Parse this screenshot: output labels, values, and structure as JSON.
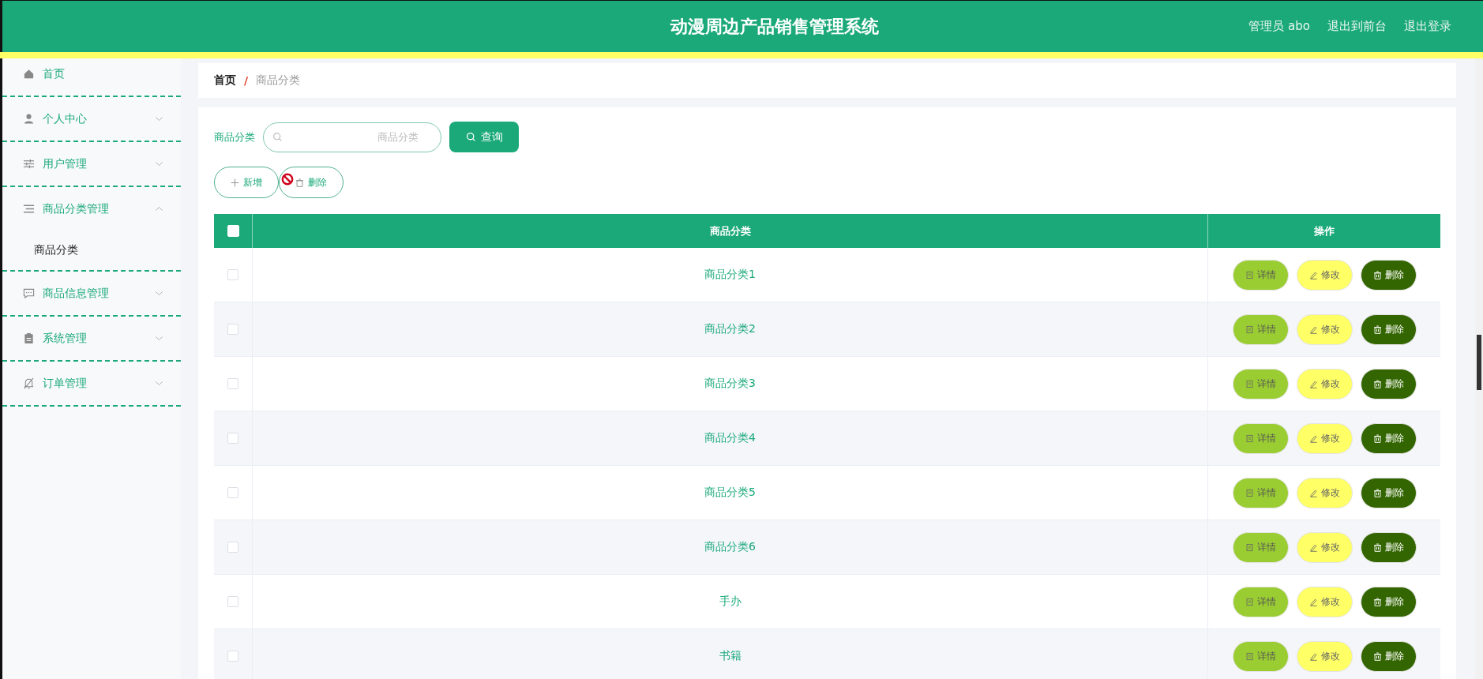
{
  "header": {
    "title": "动漫周边产品销售管理系统",
    "links": [
      "管理员 abo",
      "退出到前台",
      "退出登录"
    ]
  },
  "sidebar": {
    "items": [
      {
        "kind": "link",
        "label": "首页"
      },
      {
        "kind": "menu",
        "label": "个人中心",
        "expanded": false
      },
      {
        "kind": "menu",
        "label": "用户管理",
        "expanded": false
      },
      {
        "kind": "menu",
        "label": "商品分类管理",
        "expanded": true,
        "children": [
          {
            "label": "商品分类"
          }
        ]
      },
      {
        "kind": "menu",
        "label": "商品信息管理",
        "expanded": false
      },
      {
        "kind": "menu",
        "label": "系统管理",
        "expanded": false
      },
      {
        "kind": "menu",
        "label": "订单管理",
        "expanded": false
      }
    ]
  },
  "breadcrumb": {
    "items": [
      "首页",
      "商品分类"
    ],
    "separator": "/"
  },
  "search": {
    "label": "商品分类",
    "placeholder": "商品分类",
    "button": "查询"
  },
  "actions": [
    "新增",
    "删除"
  ],
  "table": {
    "header_checked": false,
    "columns": [
      "商品分类",
      "操作"
    ],
    "rows": [
      {
        "checked": false,
        "cell": "商品分类1",
        "actions": [
          "详情",
          "修改",
          "删除"
        ]
      },
      {
        "checked": false,
        "cell": "商品分类2",
        "actions": [
          "详情",
          "修改",
          "删除"
        ]
      },
      {
        "checked": false,
        "cell": "商品分类3",
        "actions": [
          "详情",
          "修改",
          "删除"
        ]
      },
      {
        "checked": false,
        "cell": "商品分类4",
        "actions": [
          "详情",
          "修改",
          "删除"
        ]
      },
      {
        "checked": false,
        "cell": "商品分类5",
        "actions": [
          "详情",
          "修改",
          "删除"
        ]
      },
      {
        "checked": false,
        "cell": "商品分类6",
        "actions": [
          "详情",
          "修改",
          "删除"
        ]
      },
      {
        "checked": false,
        "cell": "手办",
        "actions": [
          "详情",
          "修改",
          "删除"
        ]
      },
      {
        "checked": false,
        "cell": "书籍",
        "actions": [
          "详情",
          "修改",
          "删除"
        ]
      }
    ]
  }
}
